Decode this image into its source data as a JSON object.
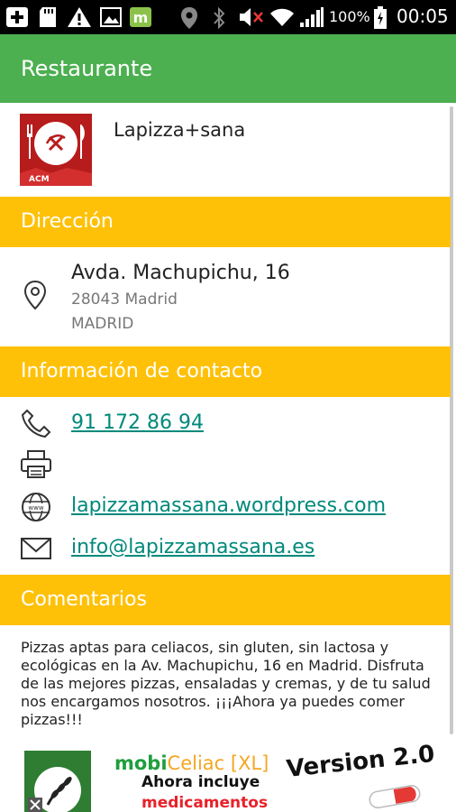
{
  "status_bar": {
    "battery_pct": "100%",
    "clock": "00:05"
  },
  "app_bar": {
    "title": "Restaurante"
  },
  "restaurant": {
    "logo_text": "ACM",
    "name": "Lapizza+sana"
  },
  "sections": {
    "address": "Dirección",
    "contact": "Información de contacto",
    "comments": "Comentarios"
  },
  "address": {
    "street": "Avda. Machupichu, 16",
    "postal_city": "28043 Madrid",
    "province": "MADRID"
  },
  "contact": {
    "phone": "91 172 86 94",
    "website": "lapizzamassana.wordpress.com",
    "email": "info@lapizzamassana.es"
  },
  "comments": {
    "text": "Pizzas aptas para celiacos, sin gluten, sin lactosa y ecológicas en la Av. Machupichu, 16 en Madrid. Disfruta de las mejores pizzas, ensaladas y cremas, y de tu salud nos encargamos nosotros. ¡¡¡Ahora ya puedes comer pizzas!!!"
  },
  "ad": {
    "brand_mobi": "mobi",
    "brand_celiac": "Celiac [XL]",
    "line2": "Ahora incluye",
    "line3": "medicamentos",
    "version": "Version 2.0"
  },
  "colors": {
    "app_bar": "#4caf50",
    "section_header": "#ffc107",
    "link": "#00897b",
    "logo_red": "#b71c1c"
  },
  "icons": [
    "notification-plus-icon",
    "sd-card-icon",
    "warning-icon",
    "image-icon",
    "market-icon",
    "location-icon",
    "bluetooth-icon",
    "mute-icon",
    "wifi-icon",
    "signal-icon",
    "battery-icon",
    "map-pin-icon",
    "phone-icon",
    "printer-icon",
    "globe-icon",
    "mail-icon"
  ]
}
